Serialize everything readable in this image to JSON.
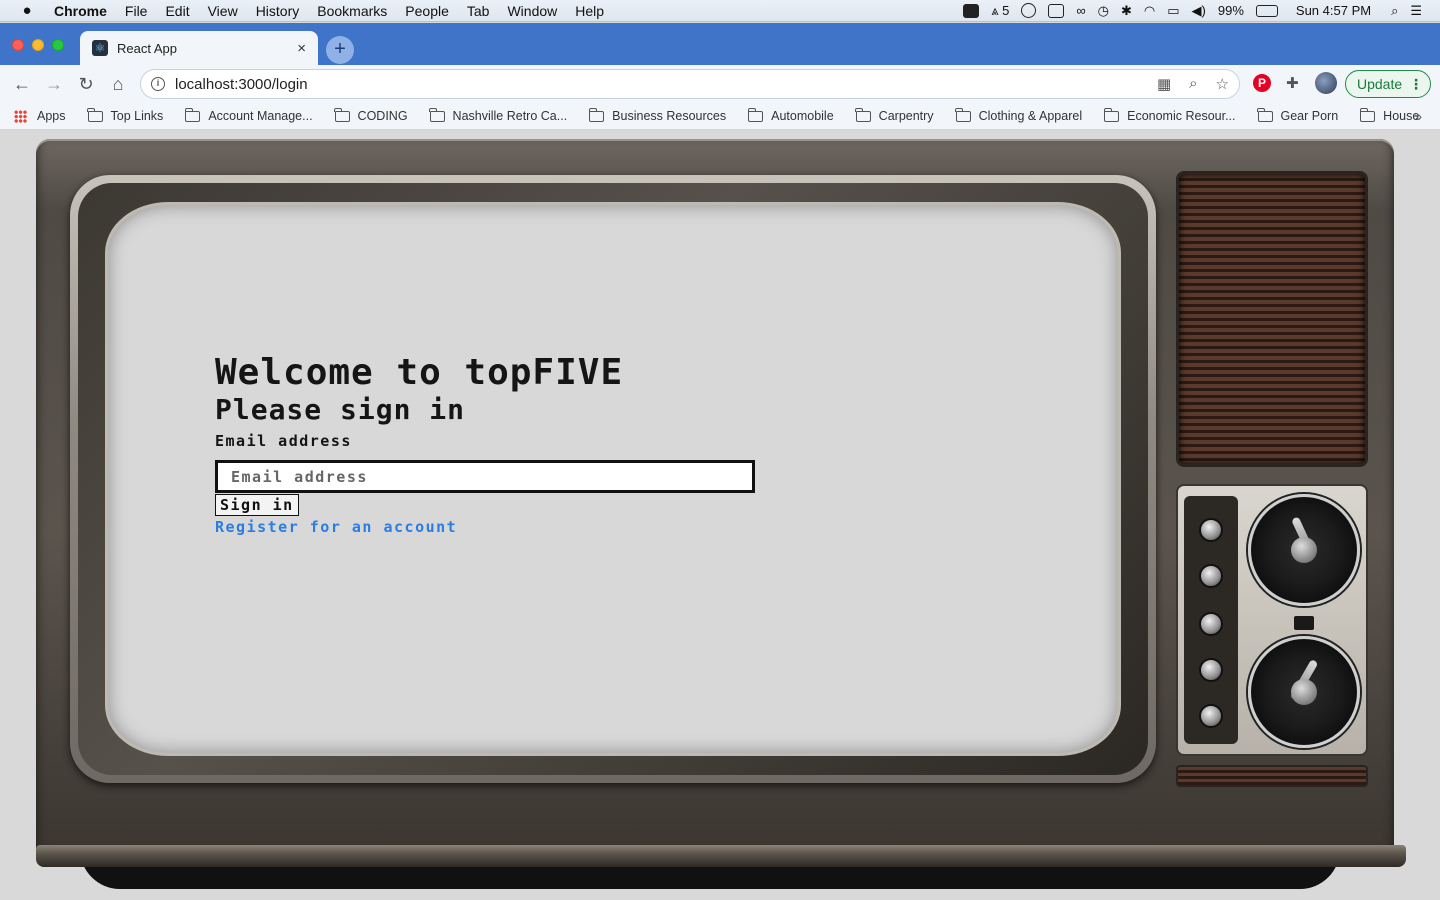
{
  "menubar": {
    "app": "Chrome",
    "items": [
      "File",
      "Edit",
      "View",
      "History",
      "Bookmarks",
      "People",
      "Tab",
      "Window",
      "Help"
    ],
    "status": {
      "adobe_count": "5",
      "battery": "99%",
      "clock": "Sun 4:57 PM"
    }
  },
  "tab": {
    "title": "React App",
    "close": "×",
    "new_tab": "+"
  },
  "toolbar": {
    "back": "←",
    "forward": "→",
    "reload": "↻",
    "home": "⌂",
    "url": "localhost:3000/login",
    "update_label": "Update",
    "menu_dots": "⋮"
  },
  "bookmarks": {
    "apps": "Apps",
    "items": [
      "Top Links",
      "Account Manage...",
      "CODING",
      "Nashville Retro Ca...",
      "Business Resources",
      "Automobile",
      "Carpentry",
      "Clothing & Apparel",
      "Economic Resour...",
      "Gear Porn",
      "House"
    ],
    "more": "»"
  },
  "login": {
    "title": "Welcome to topFIVE",
    "subtitle": "Please sign in",
    "email_label": "Email address",
    "email_placeholder": "Email address",
    "email_value": "",
    "signin_label": "Sign in",
    "register_label": "Register for an account"
  },
  "colors": {
    "link": "#2a7de1",
    "tabstrip": "#3f74c9",
    "update_green": "#1a7a3e"
  },
  "icons": [
    "apple-icon",
    "zoom-icon",
    "adobe-icon",
    "wifi-icon",
    "bluetooth-icon",
    "volume-icon",
    "battery-icon",
    "search-icon",
    "control-center-icon",
    "react-favicon",
    "info-icon",
    "qr-icon",
    "zoom-lens-icon",
    "star-icon",
    "pinterest-icon",
    "puzzle-icon",
    "profile-avatar",
    "folder-icon",
    "apps-grid-icon"
  ]
}
